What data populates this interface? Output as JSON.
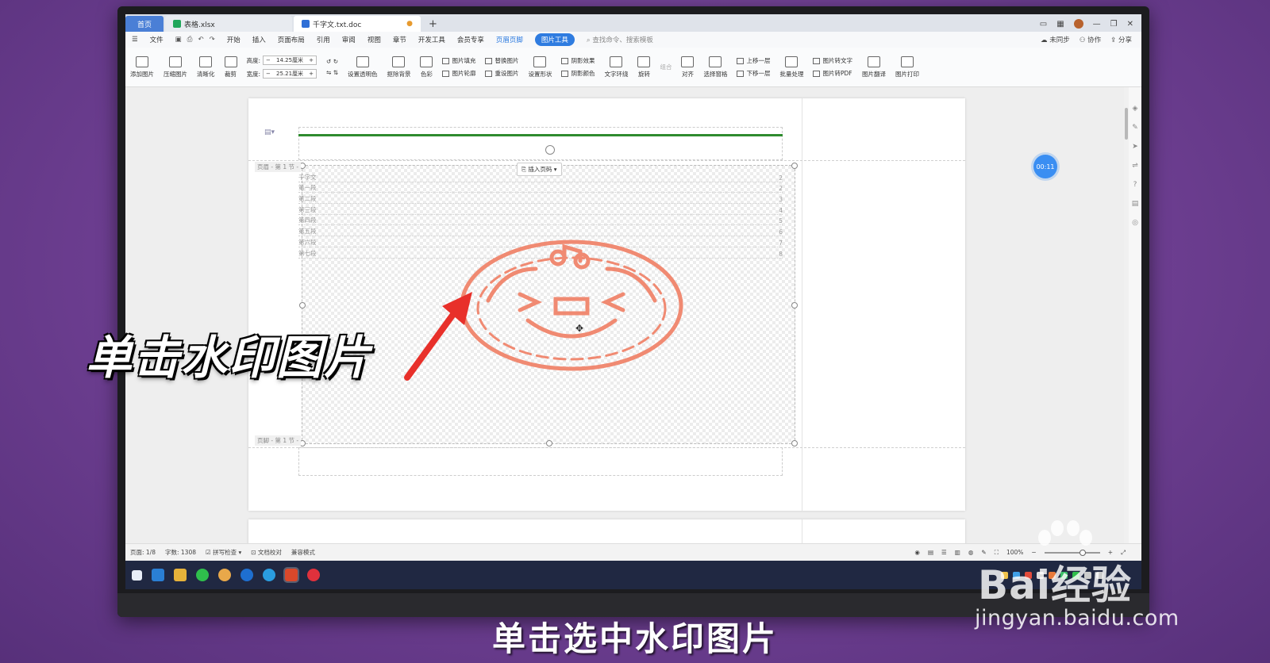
{
  "tabs": [
    {
      "label": "首页"
    },
    {
      "label": "表格.xlsx",
      "icon": "spreadsheet-icon",
      "color": "#1fa65a"
    },
    {
      "label": "千字文.txt.doc",
      "icon": "writer-doc-icon",
      "color": "#2f6fd6"
    }
  ],
  "menu": {
    "file": "文件",
    "items": [
      "开始",
      "插入",
      "页面布局",
      "引用",
      "审阅",
      "视图",
      "章节",
      "开发工具",
      "会员专享"
    ],
    "header_footer": "页眉页脚",
    "picture_tools": "图片工具",
    "search_placeholder": "查找命令、搜索模板",
    "sync": "未同步",
    "collab": "协作",
    "share": "分享"
  },
  "ribbon": {
    "add_picture": "添加图片",
    "compress": "压缩图片",
    "clarity": "清晰化",
    "crop": "裁剪",
    "height_label": "高度:",
    "height_value": "14.25厘米",
    "width_label": "宽度:",
    "width_value": "25.21厘米",
    "set_transparent": "设置透明色",
    "remove_bg": "抠除背景",
    "color": "色彩",
    "pic_fill": "图片填充",
    "pic_outline": "图片轮廓",
    "replace_pic": "替换图片",
    "reset_pic": "重设图片",
    "set_shape": "设置形状",
    "shadow_effect": "阴影效果",
    "shadow_color": "阴影颜色",
    "wrap_text": "文字环绕",
    "rotate": "旋转",
    "combine": "组合",
    "align": "对齐",
    "select_pane": "选择窗格",
    "bring_forward": "上移一层",
    "send_backward": "下移一层",
    "batch": "批量处理",
    "pic_to_text": "图片转文字",
    "pic_to_pdf": "图片转PDF",
    "pic_translate": "图片翻译",
    "pic_print": "图片打印"
  },
  "document": {
    "header_label": "页眉 - 第 1 节 -",
    "footer_label": "页脚 - 第 1 节 -",
    "insert_page_number": "插入页码",
    "toc": [
      {
        "title": "千字文",
        "page": "2"
      },
      {
        "title": "第一段",
        "page": "2"
      },
      {
        "title": "第二段",
        "page": "3"
      },
      {
        "title": "第三段",
        "page": "4"
      },
      {
        "title": "第四段",
        "page": "5"
      },
      {
        "title": "第五段",
        "page": "6"
      },
      {
        "title": "第六段",
        "page": "7"
      },
      {
        "title": "第七段",
        "page": "8"
      }
    ],
    "stamp_color": "#f08a72"
  },
  "timer": "00:11",
  "status": {
    "page": "页面: 1/8",
    "words": "字数: 1308",
    "spell": "拼写检查",
    "doc_check": "文档校对",
    "compat": "兼容模式",
    "zoom": "100%"
  },
  "overlay": {
    "instruction": "单击水印图片",
    "arrow_color": "#e8302a"
  },
  "caption": "单击选中水印图片",
  "watermark_logo": {
    "brand": "Bai经验",
    "url": "jingyan.baidu.com"
  }
}
